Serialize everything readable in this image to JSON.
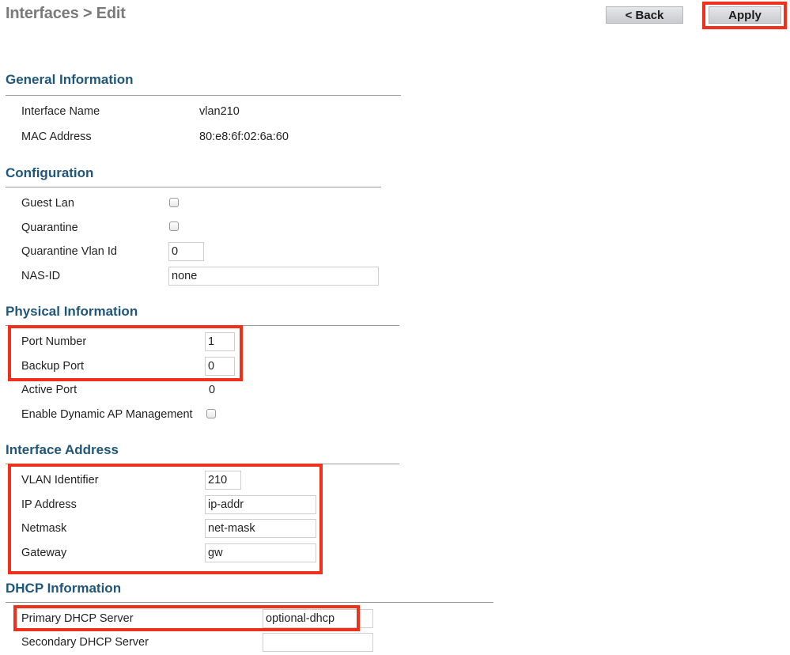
{
  "header": {
    "title": "Interfaces > Edit",
    "back_label": "< Back",
    "apply_label": "Apply"
  },
  "sections": {
    "general": "General Information",
    "configuration": "Configuration",
    "physical": "Physical Information",
    "interface_address": "Interface Address",
    "dhcp": "DHCP Information"
  },
  "general": {
    "interface_name_label": "Interface Name",
    "interface_name": "vlan210",
    "mac_label": "MAC Address",
    "mac": "80:e8:6f:02:6a:60"
  },
  "configuration": {
    "guest_lan_label": "Guest Lan",
    "guest_lan_checked": false,
    "quarantine_label": "Quarantine",
    "quarantine_checked": false,
    "quarantine_vlan_label": "Quarantine Vlan Id",
    "quarantine_vlan": "0",
    "nas_id_label": "NAS-ID",
    "nas_id": "none"
  },
  "physical": {
    "port_number_label": "Port Number",
    "port_number": "1",
    "backup_port_label": "Backup Port",
    "backup_port": "0",
    "active_port_label": "Active Port",
    "active_port": "0",
    "dynamic_ap_label": "Enable Dynamic AP Management",
    "dynamic_ap_checked": false
  },
  "interface_address": {
    "vlan_label": "VLAN Identifier",
    "vlan": "210",
    "ip_label": "IP Address",
    "ip": "ip-addr",
    "netmask_label": "Netmask",
    "netmask": "net-mask",
    "gateway_label": "Gateway",
    "gateway": "gw"
  },
  "dhcp": {
    "primary_label": "Primary DHCP Server",
    "primary": "optional-dhcp",
    "secondary_label": "Secondary DHCP Server",
    "secondary": ""
  },
  "colors": {
    "section_heading": "#1f5679",
    "highlight": "#f0301b",
    "title": "#7a7a7a"
  }
}
